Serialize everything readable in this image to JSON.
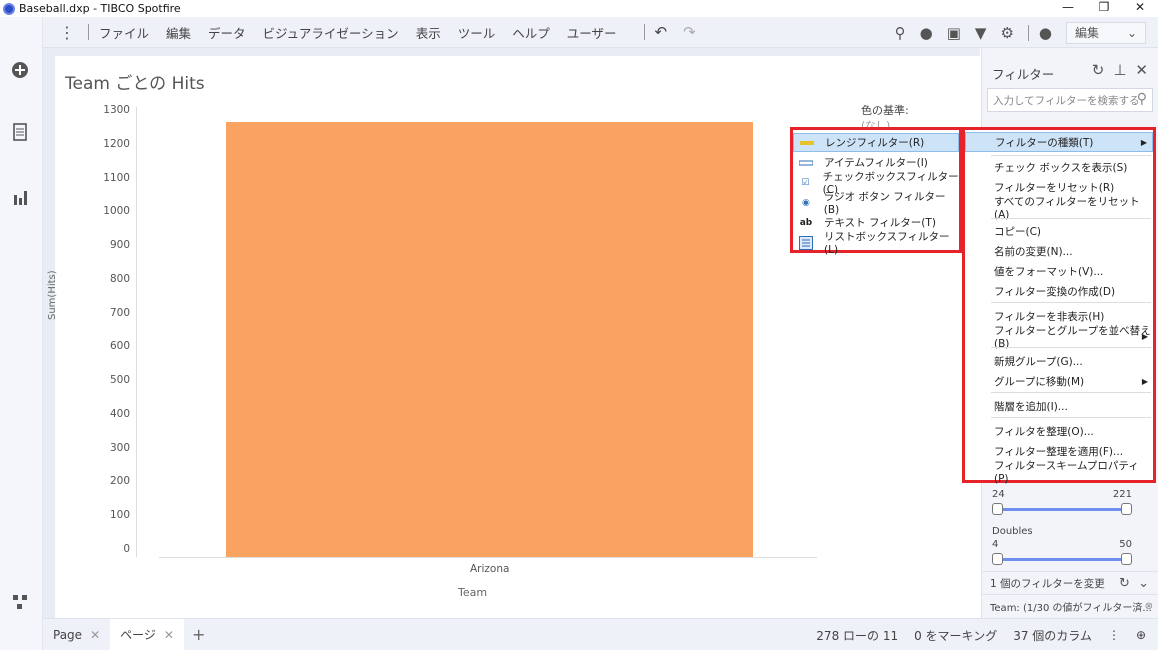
{
  "window": {
    "title": "Baseball.dxp - TIBCO Spotfire",
    "min": "—",
    "restore": "❐",
    "close": "✕"
  },
  "menu": {
    "items": [
      "ファイル",
      "編集",
      "データ",
      "ビジュアライゼーション",
      "表示",
      "ツール",
      "ヘルプ",
      "ユーザー"
    ],
    "edit_mode": "編集"
  },
  "viz": {
    "title": "Team ごとの Hits",
    "legend_title": "色の基準:",
    "legend_sub": "(なし)"
  },
  "chart_data": {
    "type": "bar",
    "categories": [
      "Arizona"
    ],
    "values": [
      1263
    ],
    "xlabel": "Team",
    "ylabel": "Sum(Hits)",
    "yticks": [
      0,
      100,
      200,
      300,
      400,
      500,
      600,
      700,
      800,
      900,
      1000,
      1100,
      1200,
      1300
    ],
    "ylim": [
      0,
      1300
    ],
    "colors": [
      "#f9a262"
    ]
  },
  "tabs": [
    {
      "label": "Page",
      "close": "✕"
    },
    {
      "label": "ページ",
      "close": "✕"
    }
  ],
  "tab_add": "+",
  "status": {
    "rows": "278 ローの 11",
    "marking": "0 をマーキング",
    "columns": "37 個のカラム"
  },
  "filter_panel": {
    "title": "フィルター",
    "search_placeholder": "入力してフィルターを検索する",
    "sliders": [
      {
        "label": "",
        "min": "24",
        "max": "221"
      },
      {
        "label": "Doubles",
        "min": "4",
        "max": "50"
      }
    ],
    "footer_changed": "1 個のフィルターを変更",
    "footer_status": "Team: (1/30 の値がフィルター済..."
  },
  "filter_type_menu": {
    "items": [
      "レンジフィルター(R)",
      "アイテムフィルター(I)",
      "チェックボックスフィルター(C)",
      "ラジオ ボタン フィルター(B)",
      "テキスト フィルター(T)",
      "リストボックスフィルター(L)"
    ],
    "selected_index": 0
  },
  "context_menu": {
    "items": [
      {
        "label": "フィルターの種類(T)",
        "submenu": true,
        "highlight": true
      },
      {
        "label": "チェック ボックスを表示(S)"
      },
      {
        "label": "フィルターをリセット(R)"
      },
      {
        "label": "すべてのフィルターをリセット(A)"
      },
      {
        "label": "コピー(C)"
      },
      {
        "label": "名前の変更(N)..."
      },
      {
        "label": "値をフォーマット(V)..."
      },
      {
        "label": "フィルター変換の作成(D)"
      },
      {
        "label": "フィルターを非表示(H)"
      },
      {
        "label": "フィルターとグループを並べ替え(B)",
        "submenu": true
      },
      {
        "label": "新規グループ(G)..."
      },
      {
        "label": "グループに移動(M)",
        "submenu": true
      },
      {
        "label": "階層を追加(I)..."
      },
      {
        "label": "フィルタを整理(O)..."
      },
      {
        "label": "フィルター整理を適用(F)..."
      },
      {
        "label": "フィルタースキームプロパティ(P)"
      }
    ]
  }
}
